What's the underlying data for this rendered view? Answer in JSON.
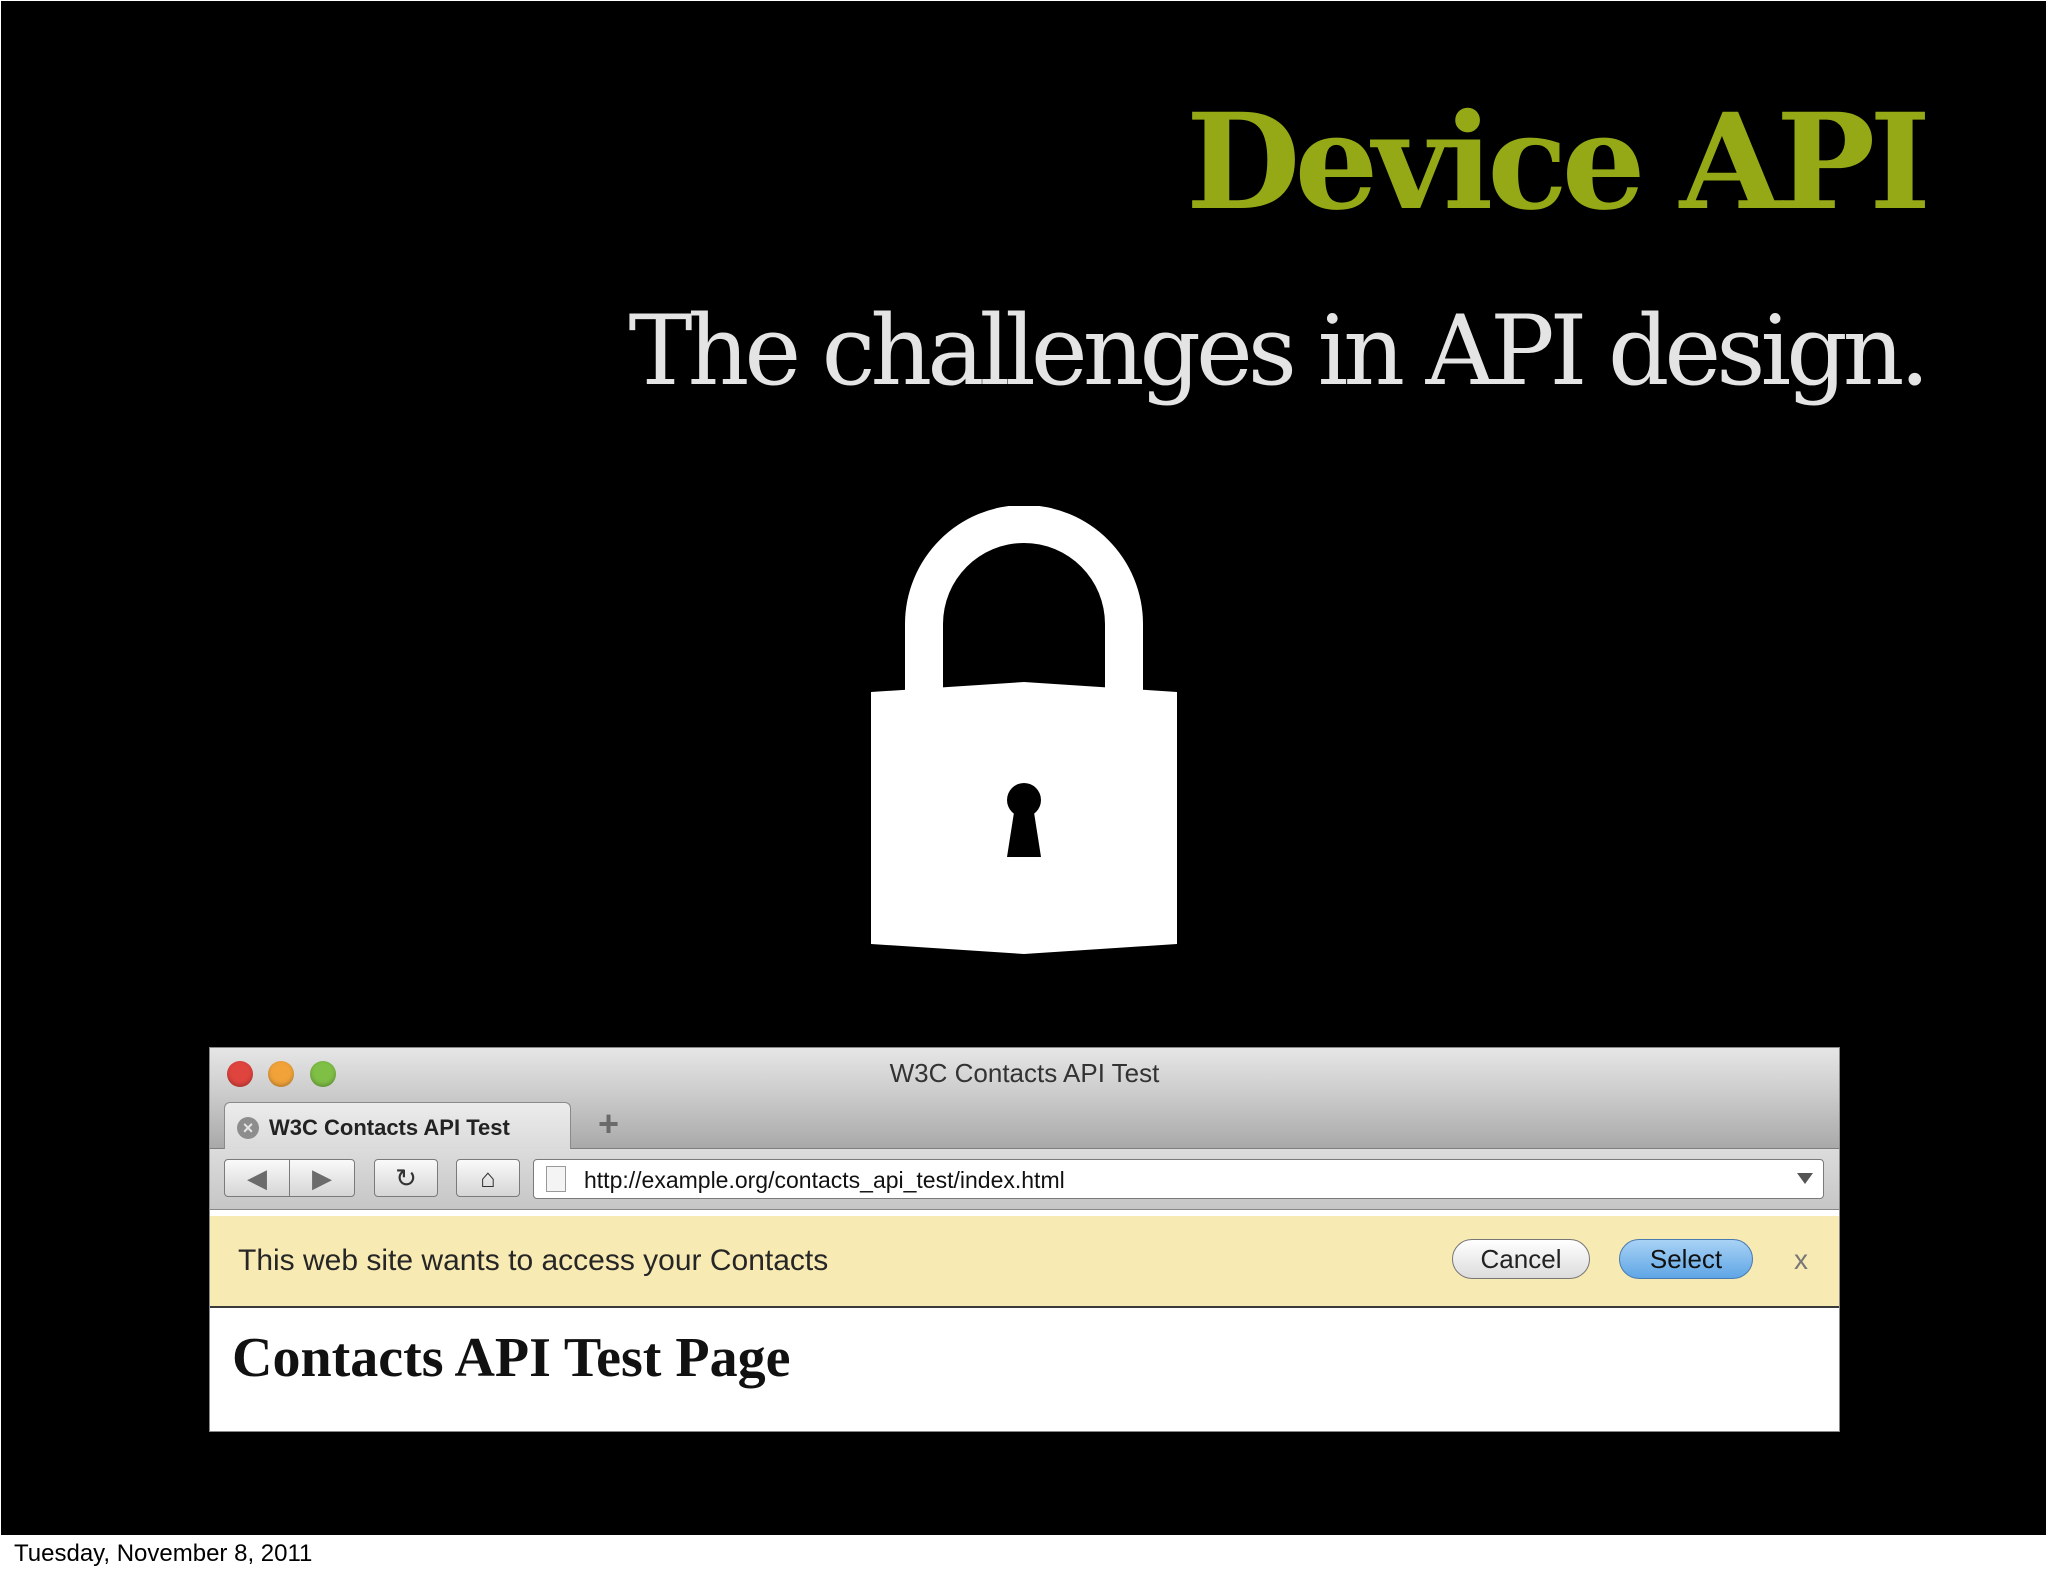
{
  "slide": {
    "title": "Device API",
    "subtitle": "The challenges in API design."
  },
  "browser": {
    "window_title": "W3C Contacts API Test",
    "tab_label": "W3C Contacts API Test",
    "url": "http://example.org/contacts_api_test/index.html",
    "notification": {
      "message": "This web site wants to access your Contacts",
      "cancel_label": "Cancel",
      "select_label": "Select",
      "close_label": "x"
    },
    "page_heading": "Contacts API Test Page"
  },
  "footer": {
    "date": "Tuesday, November 8, 2011"
  },
  "colors": {
    "title_green": "#95a815",
    "background": "#000000",
    "notification_bar": "#f8eab3",
    "select_button": "#5fa6e6"
  },
  "icons": [
    "lock-icon",
    "tab-close-icon",
    "new-tab-icon",
    "back-icon",
    "forward-icon",
    "reload-icon",
    "home-icon",
    "page-icon",
    "url-dropdown-icon"
  ]
}
